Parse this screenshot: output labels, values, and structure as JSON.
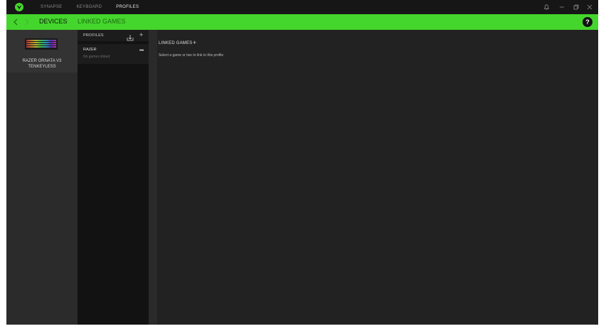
{
  "titlebar": {
    "tabs": [
      {
        "label": "SYNAPSE",
        "active": false
      },
      {
        "label": "KEYBOARD",
        "active": false
      },
      {
        "label": "PROFILES",
        "active": true
      }
    ]
  },
  "subnav": {
    "devices": "DEVICES",
    "linked_games": "LINKED GAMES",
    "help": "?"
  },
  "device": {
    "name_line1": "RAZER ORNATA V3",
    "name_line2": "TENKEYLESS"
  },
  "profiles": {
    "header": "PROFILES",
    "add": "+",
    "items": [
      {
        "name": "RAZER",
        "subtitle": "No games linked",
        "more": "•••"
      }
    ]
  },
  "linked_games": {
    "header": "LINKED GAMES",
    "add": "+",
    "description": "Select a game or two to link to this profile"
  },
  "colors": {
    "accent": "#44d62c",
    "background": "#222222",
    "titlebar": "#161616"
  }
}
